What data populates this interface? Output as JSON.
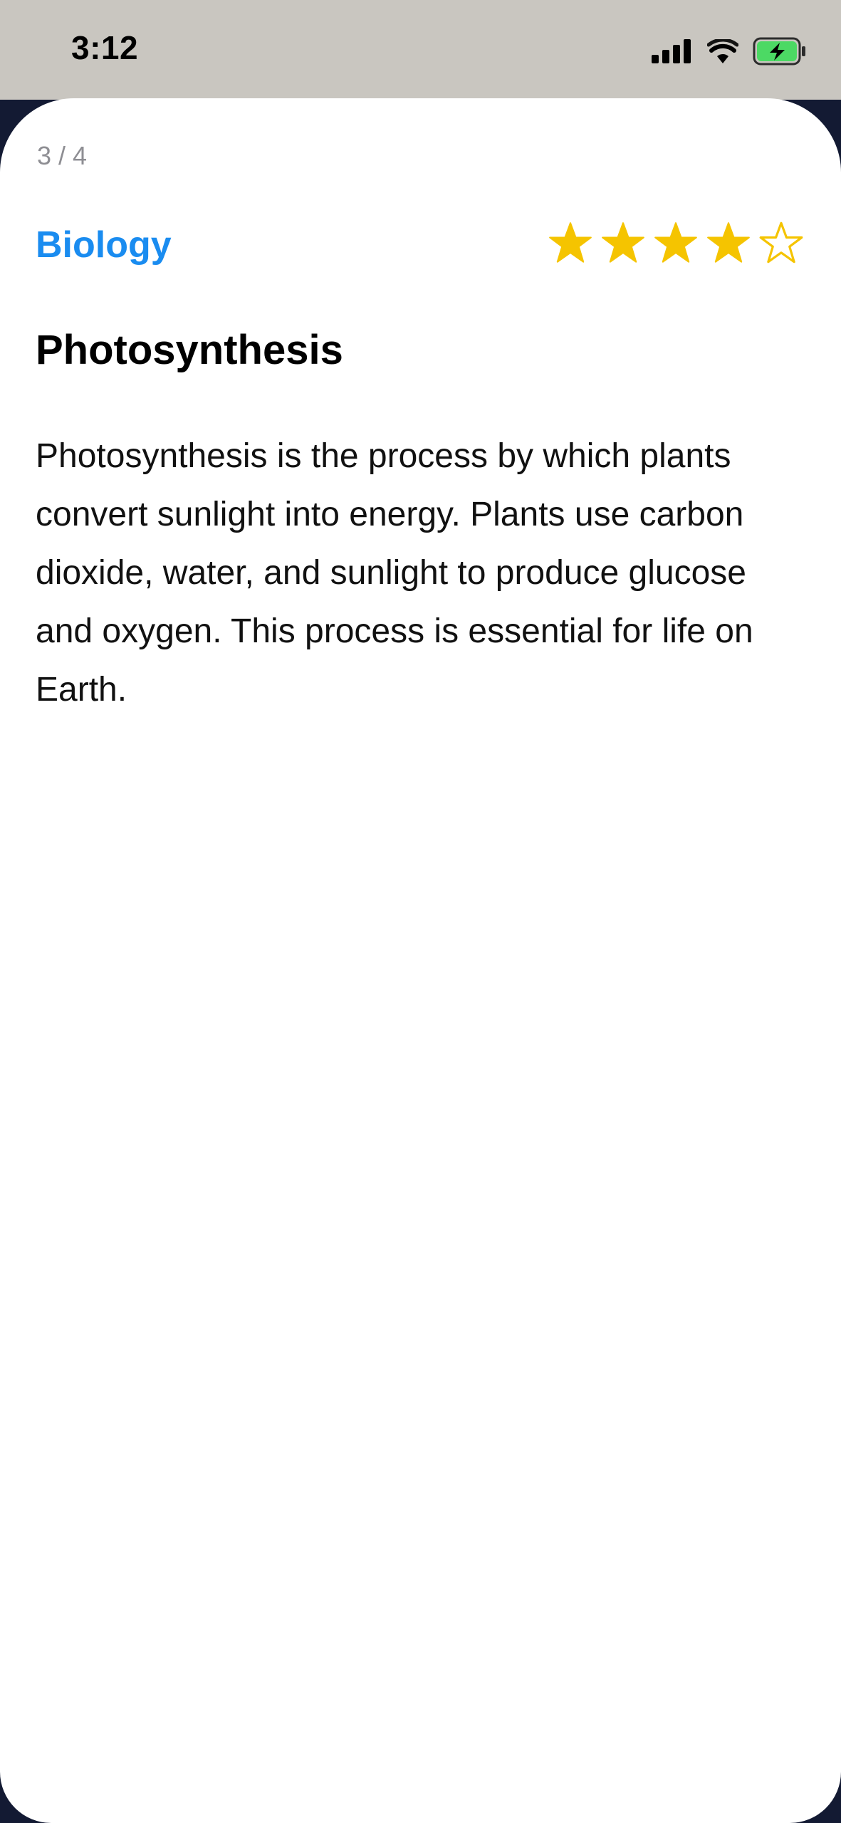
{
  "status_bar": {
    "time": "3:12",
    "icons": [
      "cellular-signal-icon",
      "wifi-icon",
      "battery-charging-icon"
    ]
  },
  "card": {
    "counter": "3 / 4",
    "category": "Biology",
    "rating": {
      "value": 4,
      "max": 5
    },
    "title": "Photosynthesis",
    "body": "Photosynthesis is the process by which plants convert sunlight into energy. Plants use carbon dioxide, water, and sunlight to produce glucose and oxygen. This process is essential for life on Earth."
  },
  "colors": {
    "accent": "#1a8cf0",
    "star": "#f5c400",
    "status_bar_bg": "#c9c6c0",
    "backdrop": "#131a33",
    "battery_fill": "#4cd964"
  }
}
